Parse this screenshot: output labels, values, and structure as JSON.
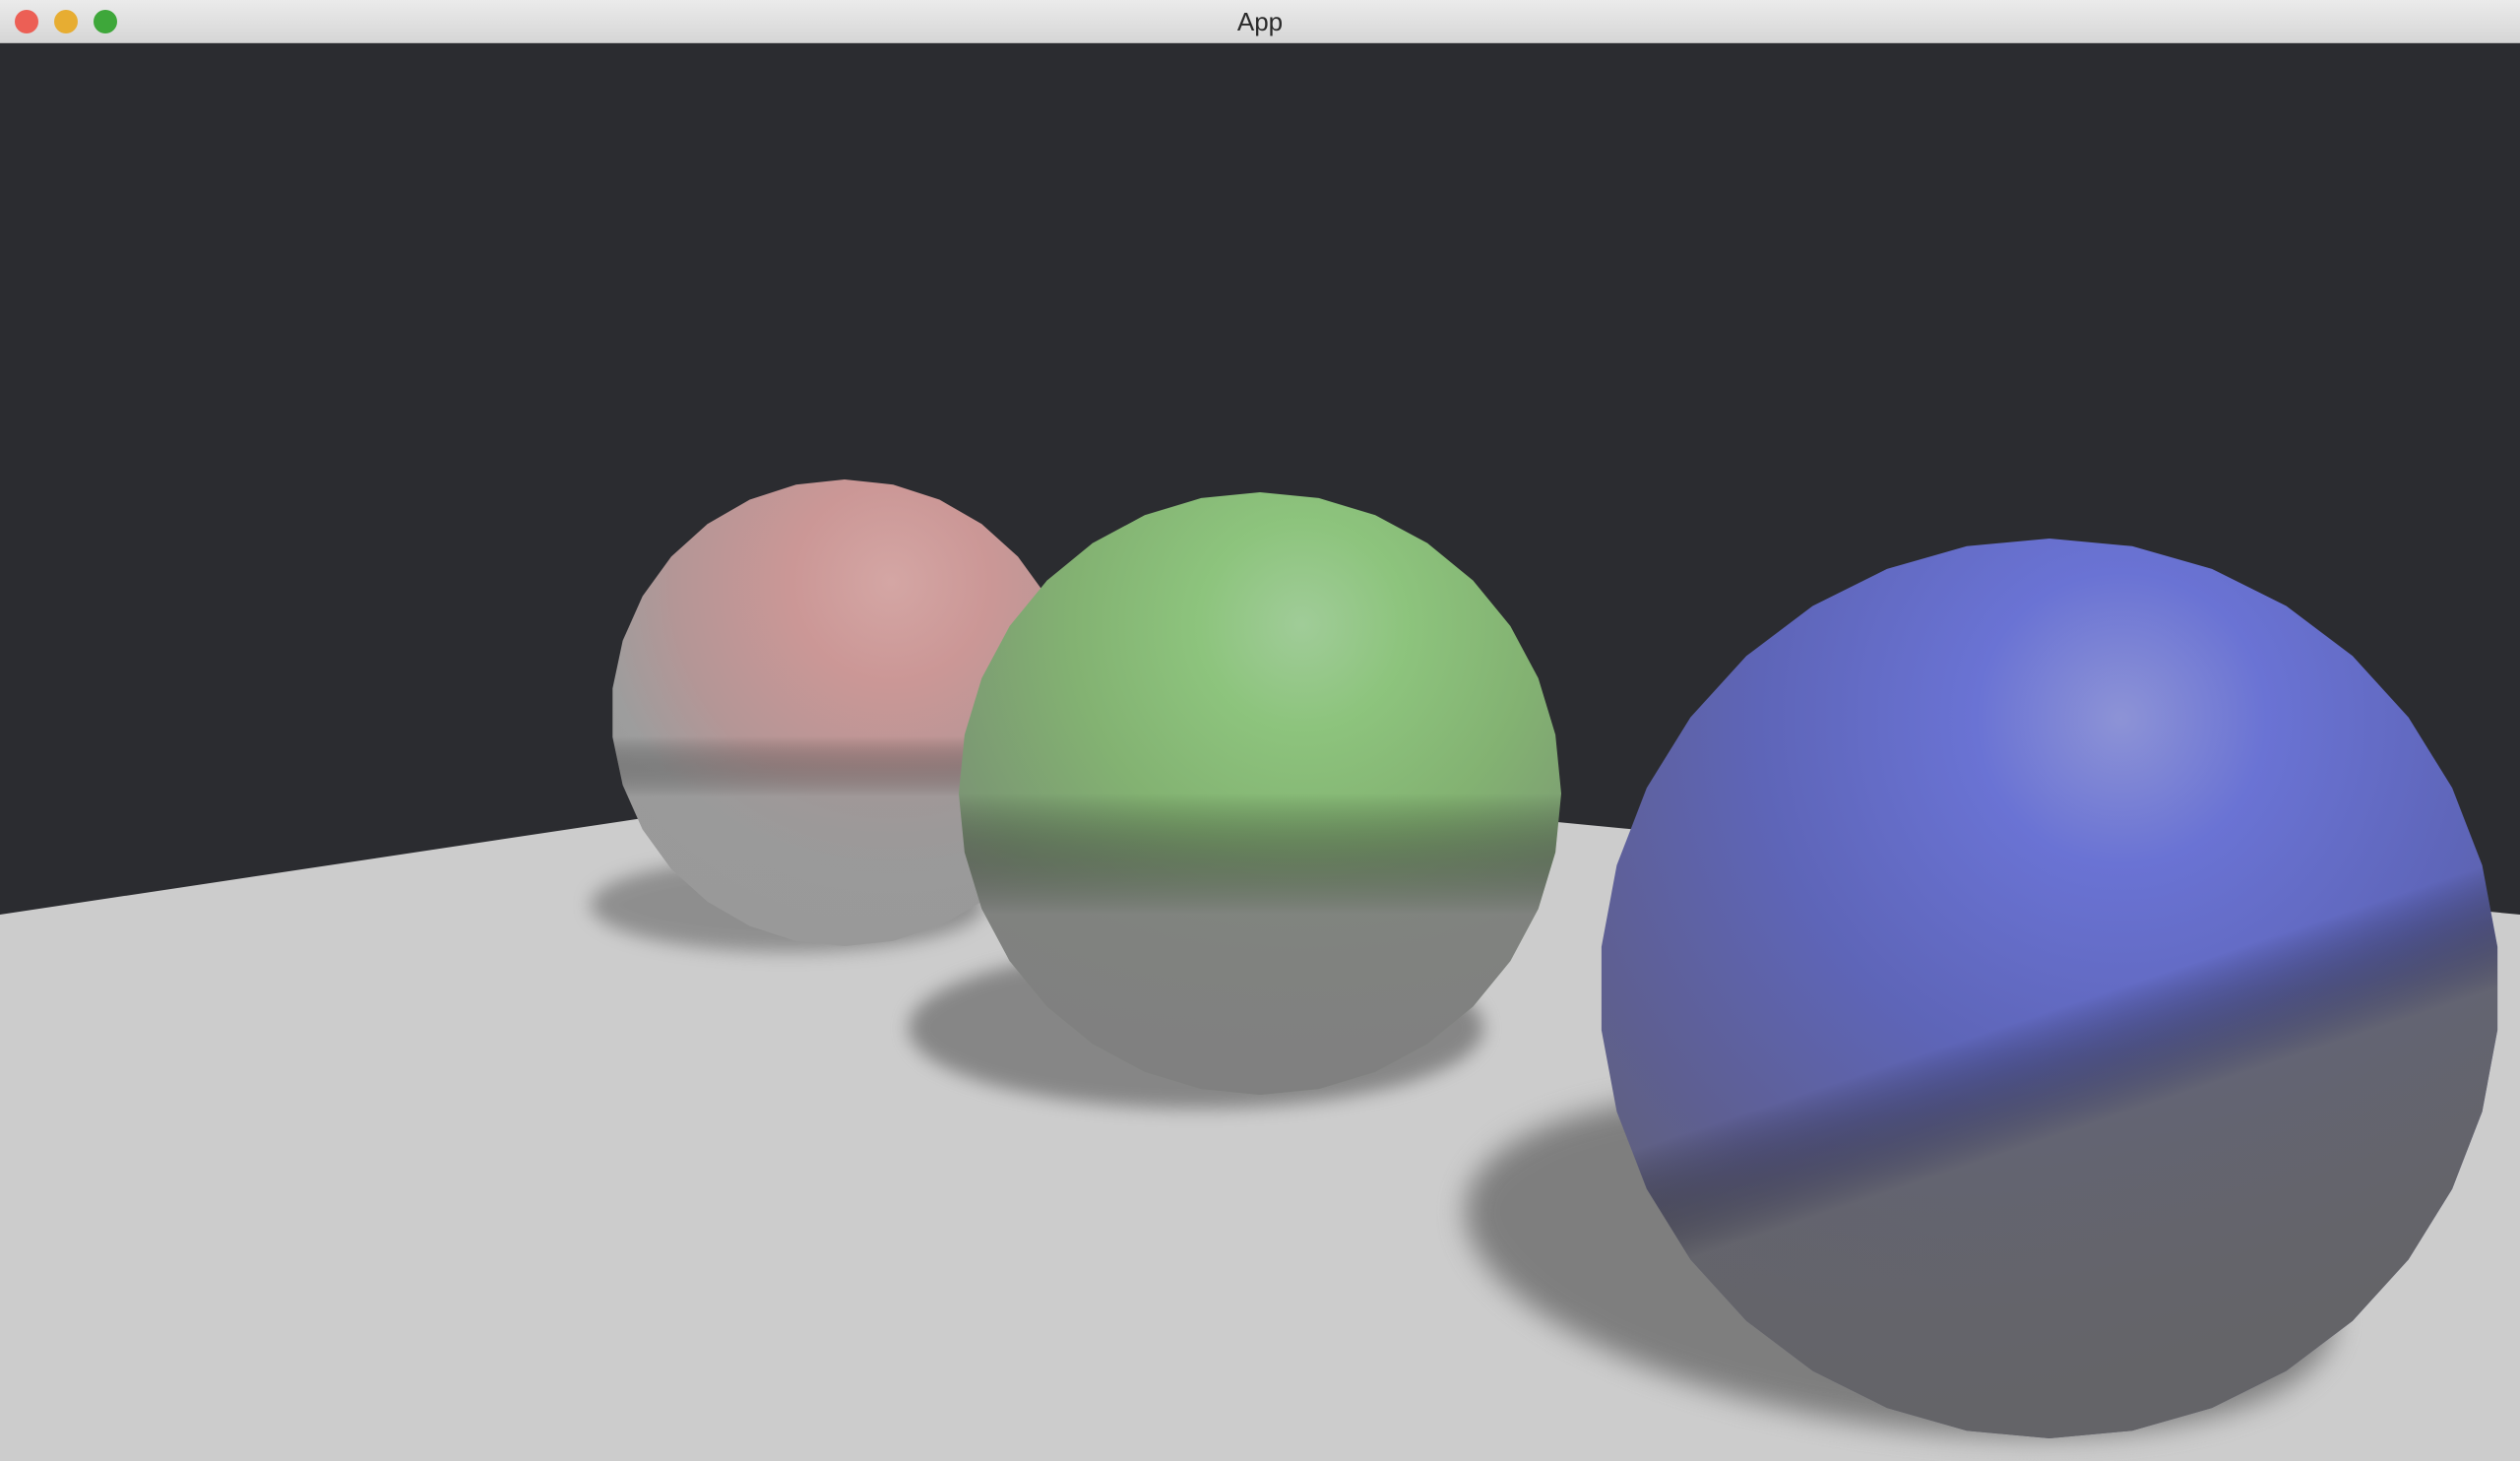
{
  "window": {
    "title": "App",
    "controls": {
      "close_color": "#ec5f55",
      "minimize_color": "#e7ad32",
      "maximize_color": "#3ea73a"
    }
  },
  "scene": {
    "background_color": "#2b2c30",
    "floor_color": "#cccccc",
    "spheres": [
      {
        "name": "red",
        "color": "#cf9a99"
      },
      {
        "name": "green",
        "color": "#8dc47d"
      },
      {
        "name": "blue",
        "color": "#6a73d4"
      }
    ]
  }
}
